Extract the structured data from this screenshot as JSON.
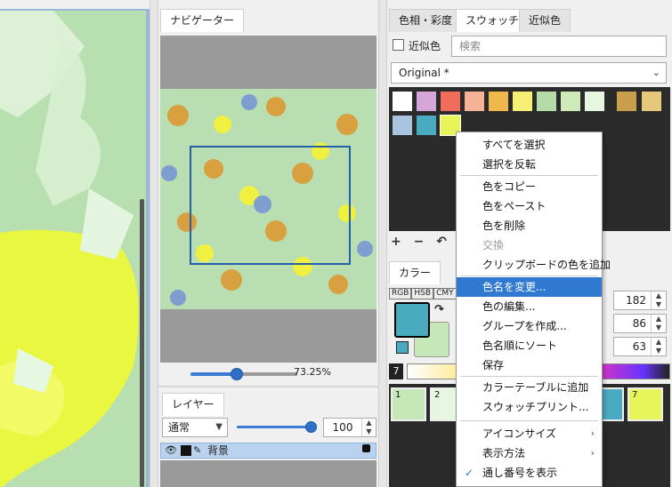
{
  "navigator": {
    "tab_label": "ナビゲーター",
    "zoom_value": "73.25%"
  },
  "layers": {
    "tab_label": "レイヤー",
    "blend_mode": "通常",
    "opacity": "100",
    "row": {
      "name": "背景"
    }
  },
  "right_tabs": [
    "色相・彩度",
    "スウォッチ",
    "近似色"
  ],
  "swatch": {
    "near_color_label": "近似色",
    "search_placeholder": "検索",
    "set_name": "Original *",
    "colors": [
      "#ffffff",
      "#d6a6d8",
      "#f26c5c",
      "#f5b296",
      "#f0b84a",
      "#f7ee74",
      "#b5dca8",
      "#cfe9b8",
      "#e6f6e0",
      "#c9a04a",
      "#e6c87a",
      "#a9c4e0",
      "#4aaac0",
      "#e8f55a"
    ],
    "toolbar": [
      "+",
      "−",
      "↶"
    ]
  },
  "color_panel": {
    "tab_label": "カラー",
    "modes": [
      "RGB",
      "HSB",
      "CMY"
    ],
    "main_color": "#4aaac0",
    "sub_color": "#c6e8b8",
    "values": [
      "182",
      "86",
      "63"
    ],
    "gradient_number": "7",
    "bottom_swatches": [
      {
        "num": "1",
        "color": "#c6e8b8"
      },
      {
        "num": "2",
        "color": "#e6f6e0"
      },
      {
        "num": "",
        "color": "#4aaac0"
      },
      {
        "num": "7",
        "color": "#e8f55a"
      }
    ]
  },
  "context_menu": {
    "items": [
      {
        "label": "すべてを選択"
      },
      {
        "label": "選択を反転"
      },
      {
        "label": "色をコピー"
      },
      {
        "label": "色をペースト"
      },
      {
        "label": "色を削除"
      },
      {
        "label": "交換",
        "disabled": true
      },
      {
        "label": "クリップボードの色を追加"
      },
      {
        "label": "色名を変更...",
        "highlighted": true
      },
      {
        "label": "色の編集..."
      },
      {
        "label": "グループを作成..."
      },
      {
        "label": "色名順にソート"
      },
      {
        "label": "保存"
      },
      {
        "label": "カラーテーブルに追加"
      },
      {
        "label": "スウォッチプリント..."
      },
      {
        "label": "アイコンサイズ",
        "submenu": true
      },
      {
        "label": "表示方法",
        "submenu": true
      },
      {
        "label": "通し番号を表示",
        "checked": true
      }
    ]
  }
}
